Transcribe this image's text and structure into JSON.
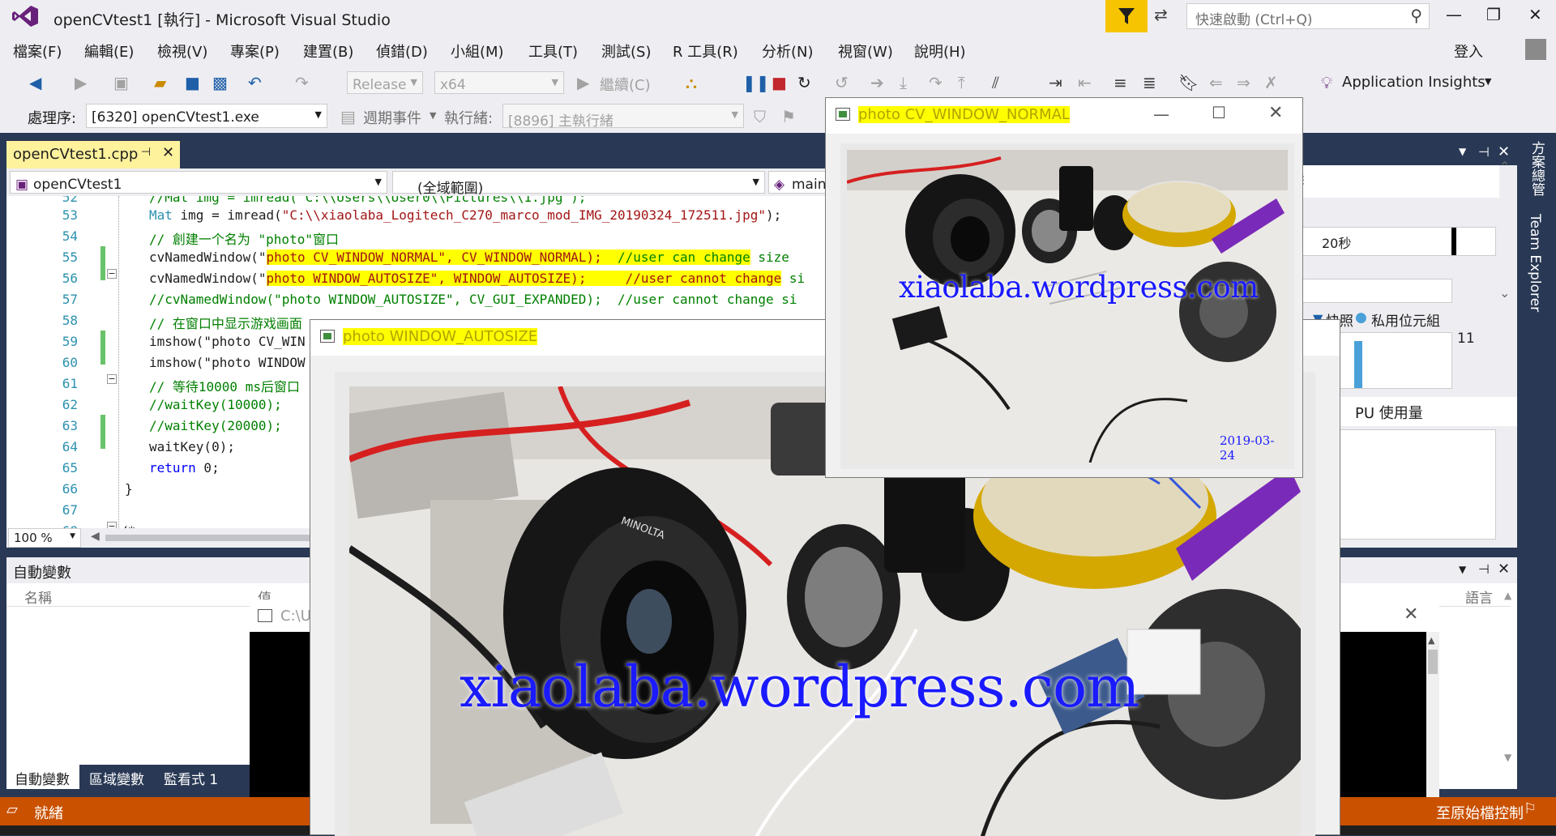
{
  "window": {
    "title": "openCVtest1 [執行] - Microsoft Visual Studio",
    "quick_launch_placeholder": "快速啟動 (Ctrl+Q)",
    "sign_in": "登入"
  },
  "menu": {
    "items": [
      "檔案(F)",
      "編輯(E)",
      "檢視(V)",
      "專案(P)",
      "建置(B)",
      "偵錯(D)",
      "小組(M)",
      "工具(T)",
      "測試(S)",
      "R 工具(R)",
      "分析(N)",
      "視窗(W)",
      "說明(H)"
    ]
  },
  "toolbar": {
    "configuration": "Release",
    "platform": "x64",
    "continue_label": "繼續(C)",
    "app_insights": "Application Insights"
  },
  "debug_toolbar": {
    "process_label": "處理序:",
    "process_value": "[6320] openCVtest1.exe",
    "lifecycle_label": "週期事件",
    "thread_label": "執行緒:",
    "thread_value": "[8896] 主執行緒"
  },
  "editor": {
    "tab_label": "openCVtest1.cpp",
    "nav_project": "openCVtest1",
    "nav_scope": "(全域範圍)",
    "nav_member": "main(",
    "zoom": "100 %",
    "line_numbers": [
      "52",
      "53",
      "54",
      "55",
      "56",
      "57",
      "58",
      "59",
      "60",
      "61",
      "62",
      "63",
      "64",
      "65",
      "66",
      "67",
      "68"
    ],
    "lines": {
      "l52": "//Mat img = imread(\"C:\\\\Users\\\\User0\\\\Pictures\\\\1.jpg\");",
      "l53a": "Mat",
      "l53b": " img = imread(",
      "l53c": "\"C:\\\\xiaolaba_Logitech_C270_marco_mod_IMG_20190324_172511.jpg\"",
      "l53d": ");",
      "l54": "// 創建一个名为 \"photo\"窗口",
      "l55a": "cvNamedWindow(\"",
      "l55b": "photo CV_WINDOW_NORMAL",
      "l55c": "\", CV_WINDOW_NORMAL);",
      "l55d": "  //user can change",
      "l55e": " size",
      "l56a": "cvNamedWindow(\"",
      "l56b": "photo WINDOW_AUTOSIZE\", WINDOW_AUTOSIZE);     //user cannot change",
      "l56c": " si",
      "l57": "//cvNamedWindow(\"photo WINDOW_AUTOSIZE\", CV_GUI_EXPANDED);  //user cannot change si",
      "l58": "// 在窗口中显示游戏画面",
      "l59": "imshow(\"photo CV_WIN",
      "l60": "imshow(\"photo WINDOW",
      "l61": "// 等待10000 ms后窗口",
      "l62": "//waitKey(10000);",
      "l63": "//waitKey(20000);",
      "l64": "waitKey(0);",
      "l65a": "return",
      "l65b": " 0;",
      "l66": "}",
      "l68": "/*"
    }
  },
  "right_panel": {
    "diag_time": "20秒",
    "snapshot_label": "快照",
    "private_bytes": "私用位元組",
    "value_11": "11",
    "cpu_label": "PU 使用量",
    "vertical_tab_1": "方案總管",
    "vertical_tab_2": "Team Explorer"
  },
  "bottom_panel": {
    "title": "自動變數",
    "col_name": "名稱",
    "col_value": "值",
    "col_lang": "語言",
    "tabs": [
      "自動變數",
      "區域變數",
      "監看式 1"
    ]
  },
  "console": {
    "title": "C:\\U"
  },
  "statusbar": {
    "left": "就緒",
    "right": "至原始檔控制"
  },
  "win_normal": {
    "title": "photo CV_WINDOW_NORMAL",
    "watermark": "xiaolaba.wordpress.com",
    "date": "2019-03-24"
  },
  "win_autosize": {
    "title": "photo WINDOW_AUTOSIZE",
    "watermark": "xiaolaba.wordpress.com",
    "lens_brand": "MINOLTA"
  },
  "colors": {
    "accent_orange": "#ca5100",
    "highlight_yellow": "#ffff00",
    "vs_dark_blue": "#293955",
    "watermark_blue": "#1a1aff"
  }
}
